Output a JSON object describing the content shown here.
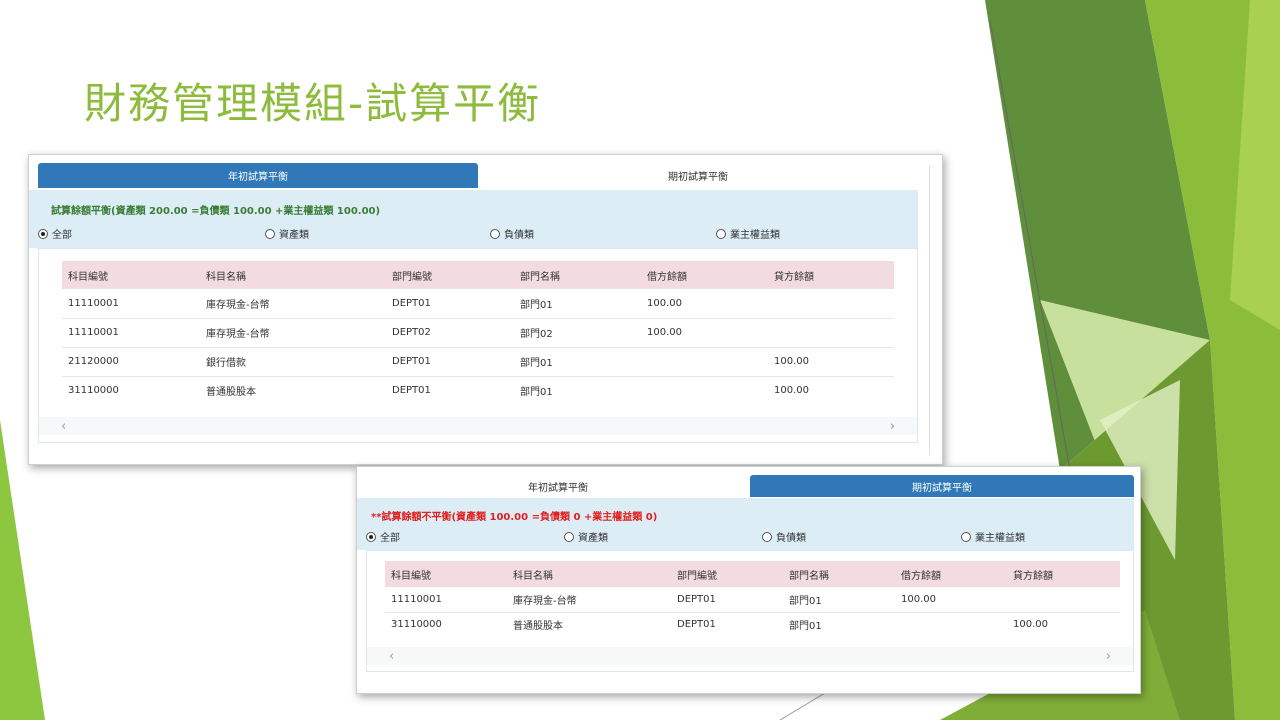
{
  "slide": {
    "title": "財務管理模組-試算平衡",
    "colors": {
      "title": "#8dbb3c",
      "accent_green": "#8dc63f",
      "dark_green": "#5a8f2a"
    }
  },
  "shot1": {
    "tabs": [
      {
        "label": "年初試算平衡",
        "active": true
      },
      {
        "label": "期初試算平衡",
        "active": false
      }
    ],
    "summary": "試算餘額平衡(資產類 200.00 =負債類 100.00 +業主權益類 100.00)",
    "summary_color": "#3a7d34",
    "filters": [
      {
        "label": "全部",
        "checked": true
      },
      {
        "label": "資產類",
        "checked": false
      },
      {
        "label": "負債類",
        "checked": false
      },
      {
        "label": "業主權益類",
        "checked": false
      }
    ],
    "columns": [
      "科目編號",
      "科目名稱",
      "部門編號",
      "部門名稱",
      "借方餘額",
      "貸方餘額"
    ],
    "rows": [
      [
        "11110001",
        "庫存現金-台幣",
        "DEPT01",
        "部門01",
        "100.00",
        ""
      ],
      [
        "11110001",
        "庫存現金-台幣",
        "DEPT02",
        "部門02",
        "100.00",
        ""
      ],
      [
        "21120000",
        "銀行借款",
        "DEPT01",
        "部門01",
        "",
        "100.00"
      ],
      [
        "31110000",
        "普通股股本",
        "DEPT01",
        "部門01",
        "",
        "100.00"
      ]
    ],
    "scroll_left": "‹",
    "scroll_right": "›"
  },
  "shot2": {
    "tabs": [
      {
        "label": "年初試算平衡",
        "active": false
      },
      {
        "label": "期初試算平衡",
        "active": true
      }
    ],
    "summary": "**試算餘額不平衡(資產類 100.00 =負債類 0 +業主權益類 0)",
    "summary_color": "#e02020",
    "filters": [
      {
        "label": "全部",
        "checked": true
      },
      {
        "label": "資產類",
        "checked": false
      },
      {
        "label": "負債類",
        "checked": false
      },
      {
        "label": "業主權益類",
        "checked": false
      }
    ],
    "columns": [
      "科目編號",
      "科目名稱",
      "部門編號",
      "部門名稱",
      "借方餘額",
      "貸方餘額"
    ],
    "rows": [
      [
        "11110001",
        "庫存現金-台幣",
        "DEPT01",
        "部門01",
        "100.00",
        ""
      ],
      [
        "31110000",
        "普通股股本",
        "DEPT01",
        "部門01",
        "",
        "100.00"
      ]
    ],
    "scroll_left": "‹",
    "scroll_right": "›"
  }
}
